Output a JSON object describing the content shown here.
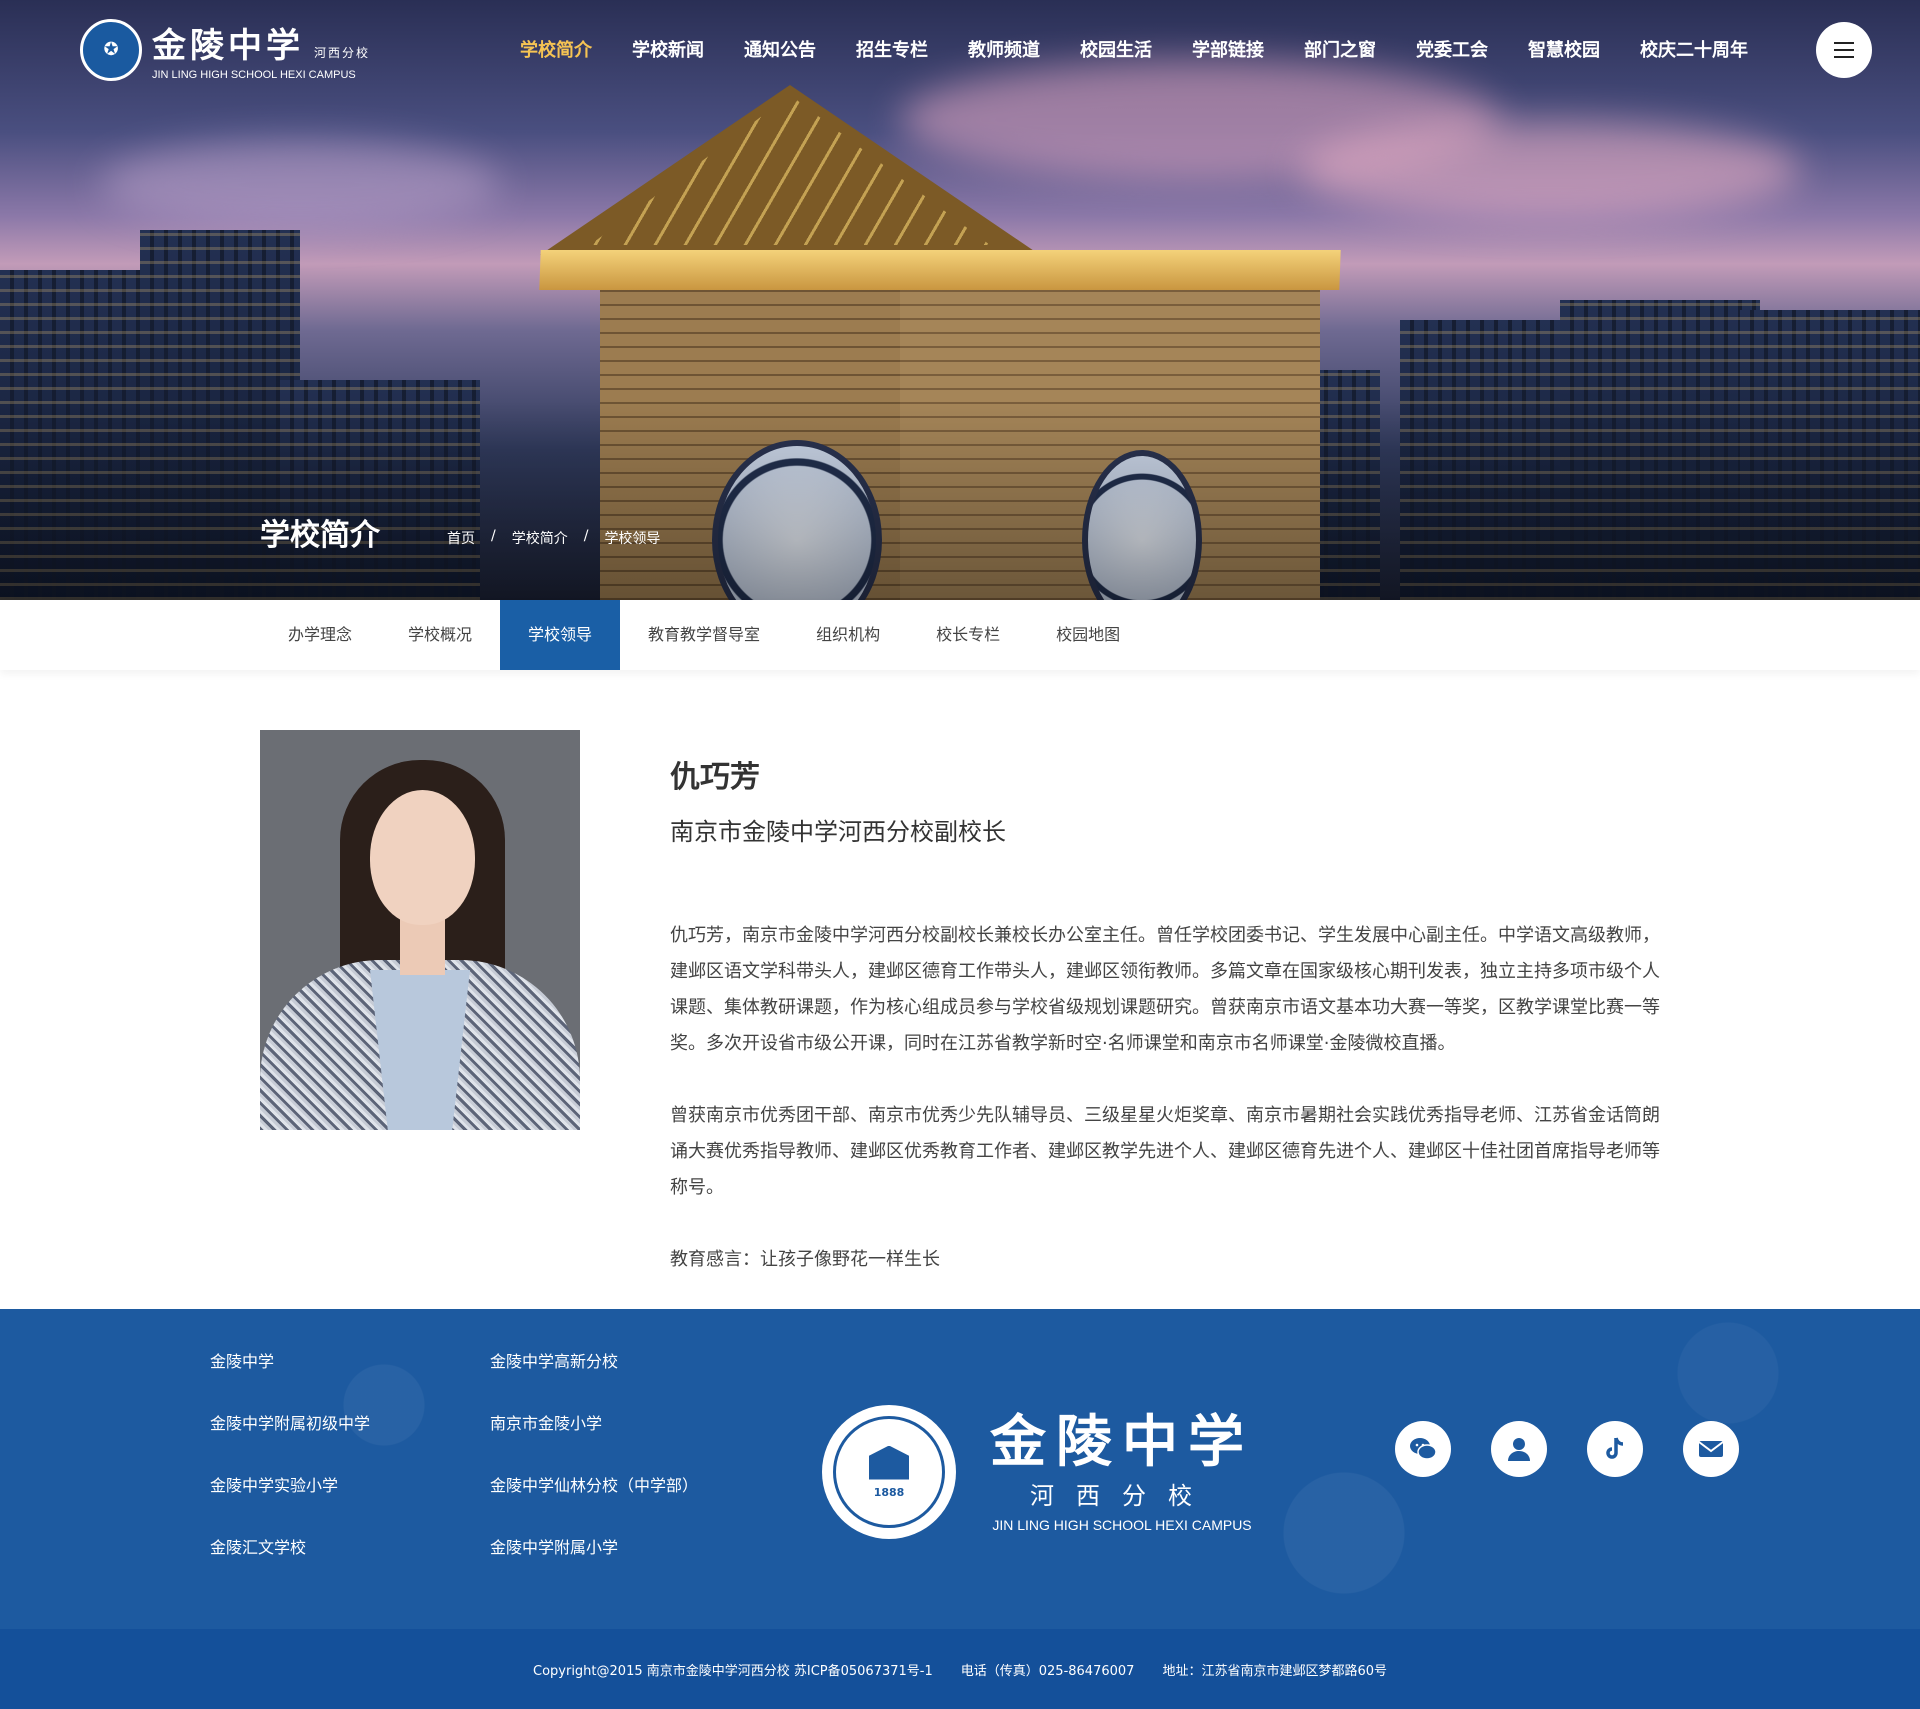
{
  "logo": {
    "cn": "金陵中学",
    "sub": "河西分校",
    "en": "JIN LING HIGH SCHOOL HEXI CAMPUS"
  },
  "nav": [
    {
      "label": "学校简介"
    },
    {
      "label": "学校新闻"
    },
    {
      "label": "通知公告"
    },
    {
      "label": "招生专栏"
    },
    {
      "label": "教师频道"
    },
    {
      "label": "校园生活"
    },
    {
      "label": "学部链接"
    },
    {
      "label": "部门之窗"
    },
    {
      "label": "党委工会"
    },
    {
      "label": "智慧校园"
    },
    {
      "label": "校庆二十周年"
    }
  ],
  "hero": {
    "title": "学校简介"
  },
  "breadcrumb": {
    "home": "首页",
    "sep": "/",
    "section": "学校简介",
    "current": "学校领导"
  },
  "subnav": [
    {
      "label": "办学理念"
    },
    {
      "label": "学校概况"
    },
    {
      "label": "学校领导"
    },
    {
      "label": "教育教学督导室"
    },
    {
      "label": "组织机构"
    },
    {
      "label": "校长专栏"
    },
    {
      "label": "校园地图"
    }
  ],
  "profile": {
    "name": "仇巧芳",
    "role": "南京市金陵中学河西分校副校长",
    "bio1": "仇巧芳，南京市金陵中学河西分校副校长兼校长办公室主任。曾任学校团委书记、学生发展中心副主任。中学语文高级教师，建邺区语文学科带头人，建邺区德育工作带头人，建邺区领衔教师。多篇文章在国家级核心期刊发表，独立主持多项市级个人课题、集体教研课题，作为核心组成员参与学校省级规划课题研究。曾获南京市语文基本功大赛一等奖，区教学课堂比赛一等奖。多次开设省市级公开课，同时在江苏省教学新时空·名师课堂和南京市名师课堂·金陵微校直播。",
    "bio2": "曾获南京市优秀团干部、南京市优秀少先队辅导员、三级星星火炬奖章、南京市暑期社会实践优秀指导老师、江苏省金话筒朗诵大赛优秀指导教师、建邺区优秀教育工作者、建邺区教学先进个人、建邺区德育先进个人、建邺区十佳社团首席指导老师等称号。",
    "motto": "教育感言：让孩子像野花一样生长"
  },
  "footer": {
    "links": [
      "金陵中学",
      "金陵中学高新分校",
      "金陵中学附属初级中学",
      "南京市金陵小学",
      "金陵中学实验小学",
      "金陵中学仙林分校（中学部）",
      "金陵汇文学校",
      "金陵中学附属小学"
    ],
    "logo_cn": "金陵中学",
    "logo_sub": "河西分校",
    "logo_en": "JIN LING HIGH SCHOOL HEXI CAMPUS",
    "badge_year": "1888",
    "social": [
      "wechat-icon",
      "user-icon",
      "tiktok-icon",
      "mail-icon"
    ],
    "copyright": "Copyright@2015 南京市金陵中学河西分校  苏ICP备05067371号-1",
    "phone": "电话（传真）025-86476007",
    "address": "地址：江苏省南京市建邺区梦都路60号"
  },
  "colors": {
    "accent": "#1a5fa6",
    "nav_active": "#f6c453",
    "footer_bg": "#1d5aa0",
    "copy_bg": "#14509a"
  }
}
